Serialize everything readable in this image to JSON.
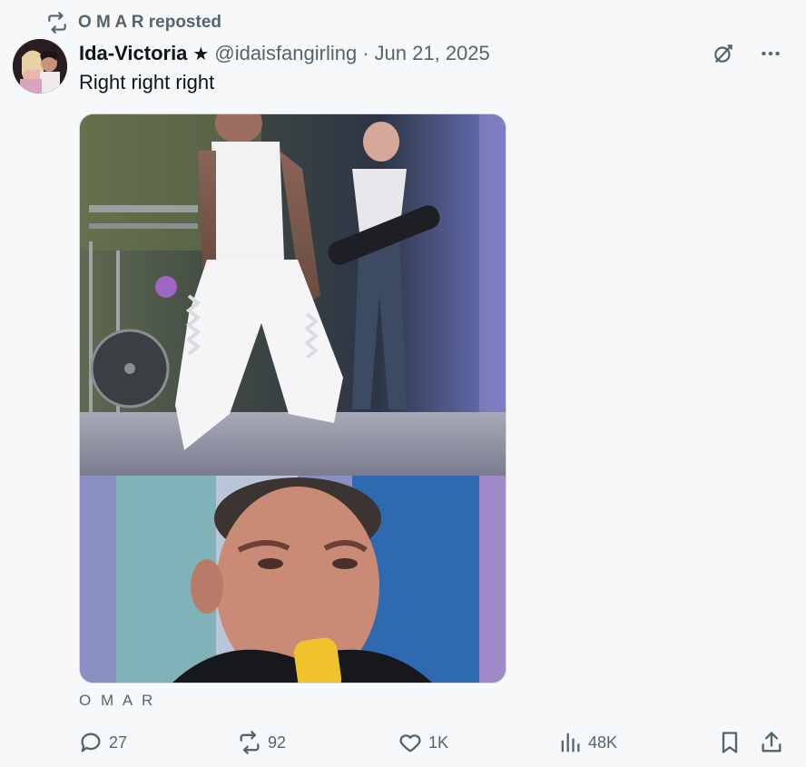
{
  "repost": {
    "reposter_name": "O M A R",
    "suffix": " reposted",
    "icon": "repost-icon"
  },
  "author": {
    "display_name": "Ida-Victoria",
    "badge": "★",
    "handle": "@idaisfangirling",
    "separator": "·",
    "date": "Jun 21, 2025"
  },
  "tweet": {
    "text": "Right right right"
  },
  "top_actions": {
    "grok_icon": "grok-icon",
    "more_icon": "more-icon"
  },
  "media": {
    "label": "O M A R"
  },
  "actions": {
    "reply_count": "27",
    "repost_count": "92",
    "like_count": "1K",
    "views_count": "48K",
    "bookmark_icon": "bookmark-icon",
    "share_icon": "share-icon"
  },
  "colors": {
    "background": "#f7f8f9",
    "text_primary": "#0f1419",
    "text_secondary": "#536471"
  }
}
